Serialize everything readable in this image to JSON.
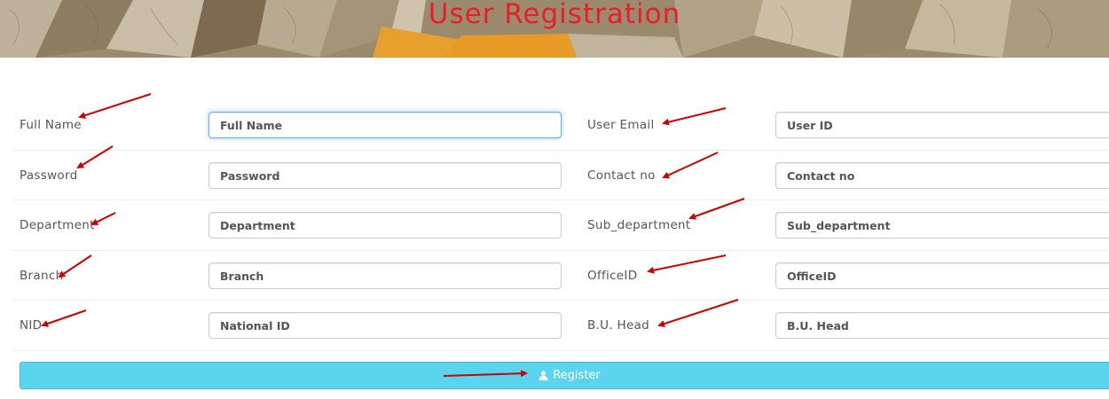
{
  "header": {
    "title": "User Registration"
  },
  "form": {
    "left": [
      {
        "label": "Full Name",
        "placeholder": "Full Name",
        "focused": true
      },
      {
        "label": "Password",
        "placeholder": "Password"
      },
      {
        "label": "Department",
        "placeholder": "Department"
      },
      {
        "label": "Branch",
        "placeholder": "Branch"
      },
      {
        "label": "NID",
        "placeholder": "National ID"
      }
    ],
    "right": [
      {
        "label": "User Email",
        "placeholder": "User ID"
      },
      {
        "label": "Contact no",
        "placeholder": "Contact no"
      },
      {
        "label": "Sub_department",
        "placeholder": "Sub_department"
      },
      {
        "label": "OfficeID",
        "placeholder": "OfficeID"
      },
      {
        "label": "B.U. Head",
        "placeholder": "B.U. Head"
      }
    ]
  },
  "register_button": {
    "label": "Register",
    "icon": "user-icon"
  },
  "colors": {
    "title": "#ee1c24",
    "button": "#5bd5ee",
    "annotation_arrow": "#cc0000",
    "focus_border": "#66afe9"
  }
}
